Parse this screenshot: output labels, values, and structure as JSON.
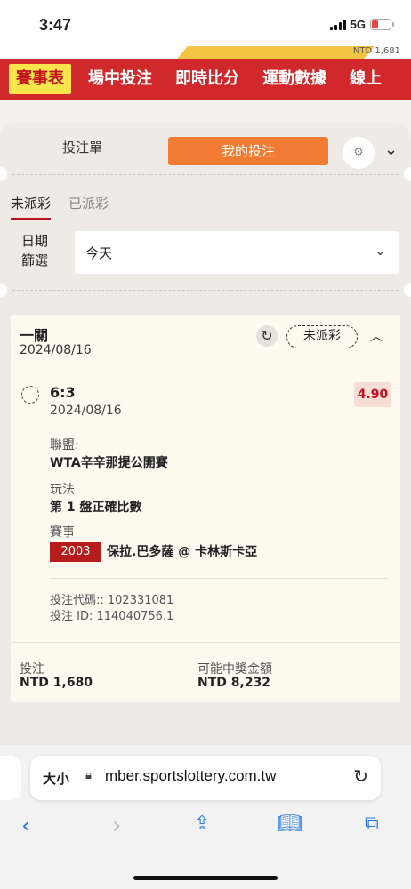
{
  "status_bar": {
    "time": "3:47",
    "network": "5G",
    "battery": "7"
  },
  "strip": {
    "text": "NTD 1,681"
  },
  "nav": {
    "items": [
      "賽事表",
      "場中投注",
      "即時比分",
      "運動數據",
      "線上"
    ]
  },
  "panel": {
    "tab_slip": "投注單",
    "tab_my_bets": "我的投注",
    "gear_icon": "gear-icon",
    "subtabs": [
      "未派彩",
      "已派彩"
    ],
    "date_filter_label": "日期篩選",
    "date_filter_value": "今天"
  },
  "bet": {
    "type": "一關",
    "date": "2024/08/16",
    "status": "未派彩",
    "selection": {
      "score": "6:3",
      "date": "2024/08/16",
      "odds": "4.90",
      "league_label": "聯盟:",
      "league": "WTA辛辛那提公開賽",
      "market_label": "玩法",
      "market": "第 1 盤正確比數",
      "event_label": "賽事",
      "event_code": "2003",
      "event_name": "保拉.巴多薩 @ 卡林斯卡亞"
    },
    "bet_code": "投注代碼:: 102331081",
    "bet_id": "投注 ID: 114040756.1",
    "stake_label": "投注",
    "stake": "NTD 1,680",
    "potential_label": "可能中獎金額",
    "potential": "NTD 8,232"
  },
  "browser": {
    "aa": "大小",
    "url": "mber.sportslottery.com.tw"
  }
}
